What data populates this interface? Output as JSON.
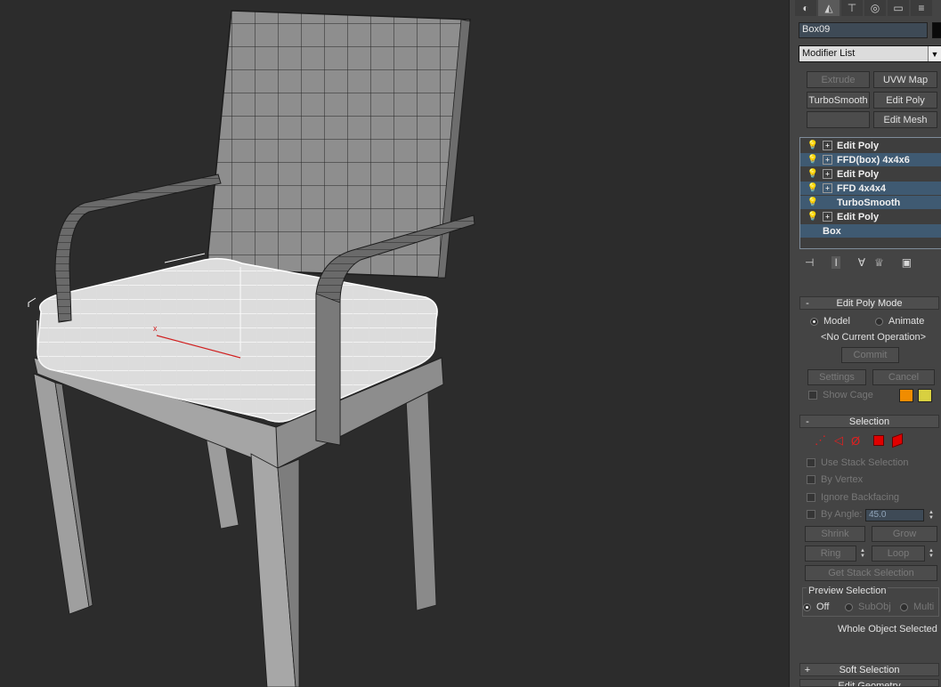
{
  "command_panel": {
    "tabs": [
      "create-icon",
      "modify-icon",
      "hierarchy-icon",
      "motion-icon",
      "display-icon",
      "utilities-icon"
    ],
    "object_name": "Box09",
    "modifier_list_label": "Modifier List",
    "modifier_buttons": [
      {
        "label": "Extrude",
        "enabled": false
      },
      {
        "label": "UVW Map",
        "enabled": true
      },
      {
        "label": "TurboSmooth",
        "enabled": true
      },
      {
        "label": "Edit Poly",
        "enabled": true
      },
      {
        "label": "",
        "enabled": false
      },
      {
        "label": "Edit Mesh",
        "enabled": true
      }
    ],
    "stack": [
      {
        "label": "Edit Poly",
        "bulb": true,
        "expandable": true,
        "selected": false
      },
      {
        "label": "FFD(box) 4x4x6",
        "bulb": true,
        "expandable": true,
        "selected": true
      },
      {
        "label": "Edit Poly",
        "bulb": true,
        "expandable": true,
        "selected": false
      },
      {
        "label": "FFD 4x4x4",
        "bulb": true,
        "expandable": true,
        "selected": true
      },
      {
        "label": "TurboSmooth",
        "bulb": true,
        "expandable": false,
        "selected": true
      },
      {
        "label": "Edit Poly",
        "bulb": true,
        "expandable": true,
        "selected": false
      },
      {
        "label": "Box",
        "bulb": false,
        "expandable": false,
        "selected": true
      }
    ],
    "stack_tools": [
      "pin-stack-icon",
      "show-end-result-icon",
      "make-unique-icon",
      "remove-modifier-icon",
      "configure-modifier-sets-icon"
    ],
    "edit_poly_mode": {
      "header": "Edit Poly Mode",
      "sign": "-",
      "model_label": "Model",
      "animate_label": "Animate",
      "current_op": "<No Current Operation>",
      "commit_label": "Commit",
      "settings_label": "Settings",
      "cancel_label": "Cancel",
      "show_cage_label": "Show Cage",
      "cage_colors": [
        "#f08c00",
        "#d8d040"
      ]
    },
    "selection": {
      "header": "Selection",
      "sign": "-",
      "subobject_icons": [
        "vertex-icon",
        "edge-icon",
        "border-icon",
        "polygon-icon",
        "element-icon"
      ],
      "use_stack_selection": "Use Stack Selection",
      "by_vertex": "By Vertex",
      "ignore_backfacing": "Ignore Backfacing",
      "by_angle": "By Angle:",
      "by_angle_value": "45.0",
      "shrink": "Shrink",
      "grow": "Grow",
      "ring": "Ring",
      "loop": "Loop",
      "get_stack_selection": "Get Stack Selection",
      "preview_selection": "Preview Selection",
      "preview_off": "Off",
      "preview_subobj": "SubObj",
      "preview_multi": "Multi",
      "status": "Whole Object Selected"
    },
    "soft_selection": {
      "header": "Soft Selection",
      "sign": "+"
    },
    "edit_geometry": {
      "header": "Edit Geometry"
    }
  }
}
